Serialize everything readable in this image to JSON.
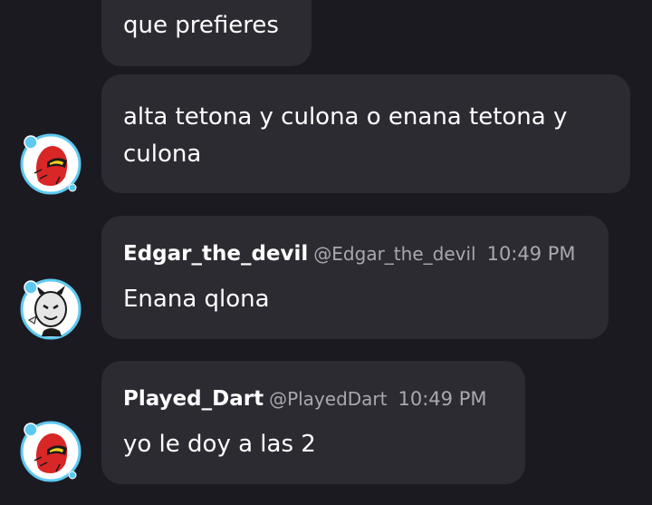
{
  "messages": [
    {
      "text": "que prefieres"
    },
    {
      "line1": "alta tetona y culona o enana tetona y",
      "line2": "culona"
    },
    {
      "author": "Edgar_the_devil",
      "handle": "@Edgar_the_devil",
      "time": "10:49 PM",
      "text": "Enana qlona"
    },
    {
      "author": "Played_Dart",
      "handle": "@PlayedDart",
      "time": "10:49 PM",
      "text": "yo le doy a las 2"
    }
  ],
  "avatars": [
    {
      "icon": "spider-face-avatar-icon",
      "ring_color": "#5ec8f0",
      "face_color": "#d92626"
    },
    {
      "icon": "masked-face-avatar-icon",
      "ring_color": "#5ec8f0",
      "face_color": "#e6e6e6"
    },
    {
      "icon": "spider-face-avatar-icon",
      "ring_color": "#5ec8f0",
      "face_color": "#d92626"
    }
  ],
  "colors": {
    "background": "#1b1a21",
    "bubble": "#2c2b32",
    "muted_text": "#a9a8ae"
  }
}
